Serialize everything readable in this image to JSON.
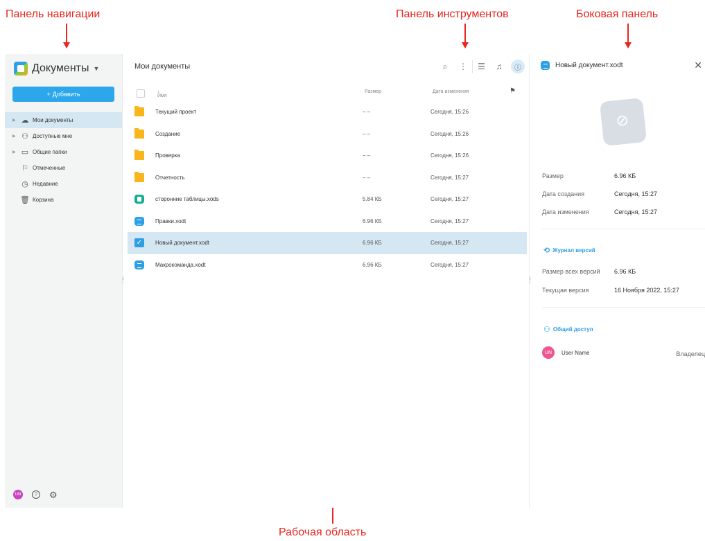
{
  "annotations": {
    "nav_panel": "Панель навигации",
    "toolbar": "Панель инструментов",
    "side_panel": "Боковая панель",
    "work_area": "Рабочая область"
  },
  "sidebar": {
    "title": "Документы",
    "add_label": "Добавить",
    "items": [
      {
        "label": "Мои документы",
        "icon": "cloud-icon"
      },
      {
        "label": "Доступные мне",
        "icon": "users-icon"
      },
      {
        "label": "Общие папки",
        "icon": "briefcase-icon"
      },
      {
        "label": "Отмеченные",
        "icon": "flag-icon"
      },
      {
        "label": "Недавние",
        "icon": "clock-icon"
      },
      {
        "label": "Корзина",
        "icon": "trash-icon"
      }
    ],
    "user_initials": "UN"
  },
  "main": {
    "title": "Мои документы",
    "columns": {
      "name": "Имя",
      "size": "Размер",
      "modified": "Дата изменения"
    },
    "rows": [
      {
        "type": "folder",
        "name": "Текущий проект",
        "size": "– –",
        "date": "Сегодня, 15:26"
      },
      {
        "type": "folder",
        "name": "Создание",
        "size": "– –",
        "date": "Сегодня, 15:26"
      },
      {
        "type": "folder",
        "name": "Проверка",
        "size": "– –",
        "date": "Сегодня, 15:26"
      },
      {
        "type": "folder",
        "name": "Отчетность",
        "size": "– –",
        "date": "Сегодня, 15:27"
      },
      {
        "type": "sheet",
        "name": "сторонние таблицы.xods",
        "size": "5.84 КБ",
        "date": "Сегодня, 15:27"
      },
      {
        "type": "doc",
        "name": "Правки.xodt",
        "size": "6.96 КБ",
        "date": "Сегодня, 15:27"
      },
      {
        "type": "checked",
        "name": "Новый документ.xodt",
        "size": "6.96 КБ",
        "date": "Сегодня, 15:27"
      },
      {
        "type": "doc",
        "name": "Макрокоманда.xodt",
        "size": "6.96 КБ",
        "date": "Сегодня, 15:27"
      }
    ]
  },
  "side": {
    "title": "Новый документ.xodt",
    "props": [
      {
        "label": "Размер",
        "value": "6.96 КБ"
      },
      {
        "label": "Дата создания",
        "value": "Сегодня, 15:27"
      },
      {
        "label": "Дата изменения",
        "value": "Сегодня, 15:27"
      }
    ],
    "history_link": "Журнал версий",
    "versions": [
      {
        "label": "Размер всех версий",
        "value": "6.96 КБ"
      },
      {
        "label": "Текущая версия",
        "value": "16 Ноября 2022, 15:27"
      }
    ],
    "share_link": "Общий доступ",
    "user": {
      "initials": "UN",
      "name": "User Name",
      "role": "Владелец"
    }
  },
  "colors": {
    "accent": "#2da7ec",
    "selected_row": "#d4e7f3",
    "folder": "#f8b51c",
    "annotation": "#e8261e"
  }
}
